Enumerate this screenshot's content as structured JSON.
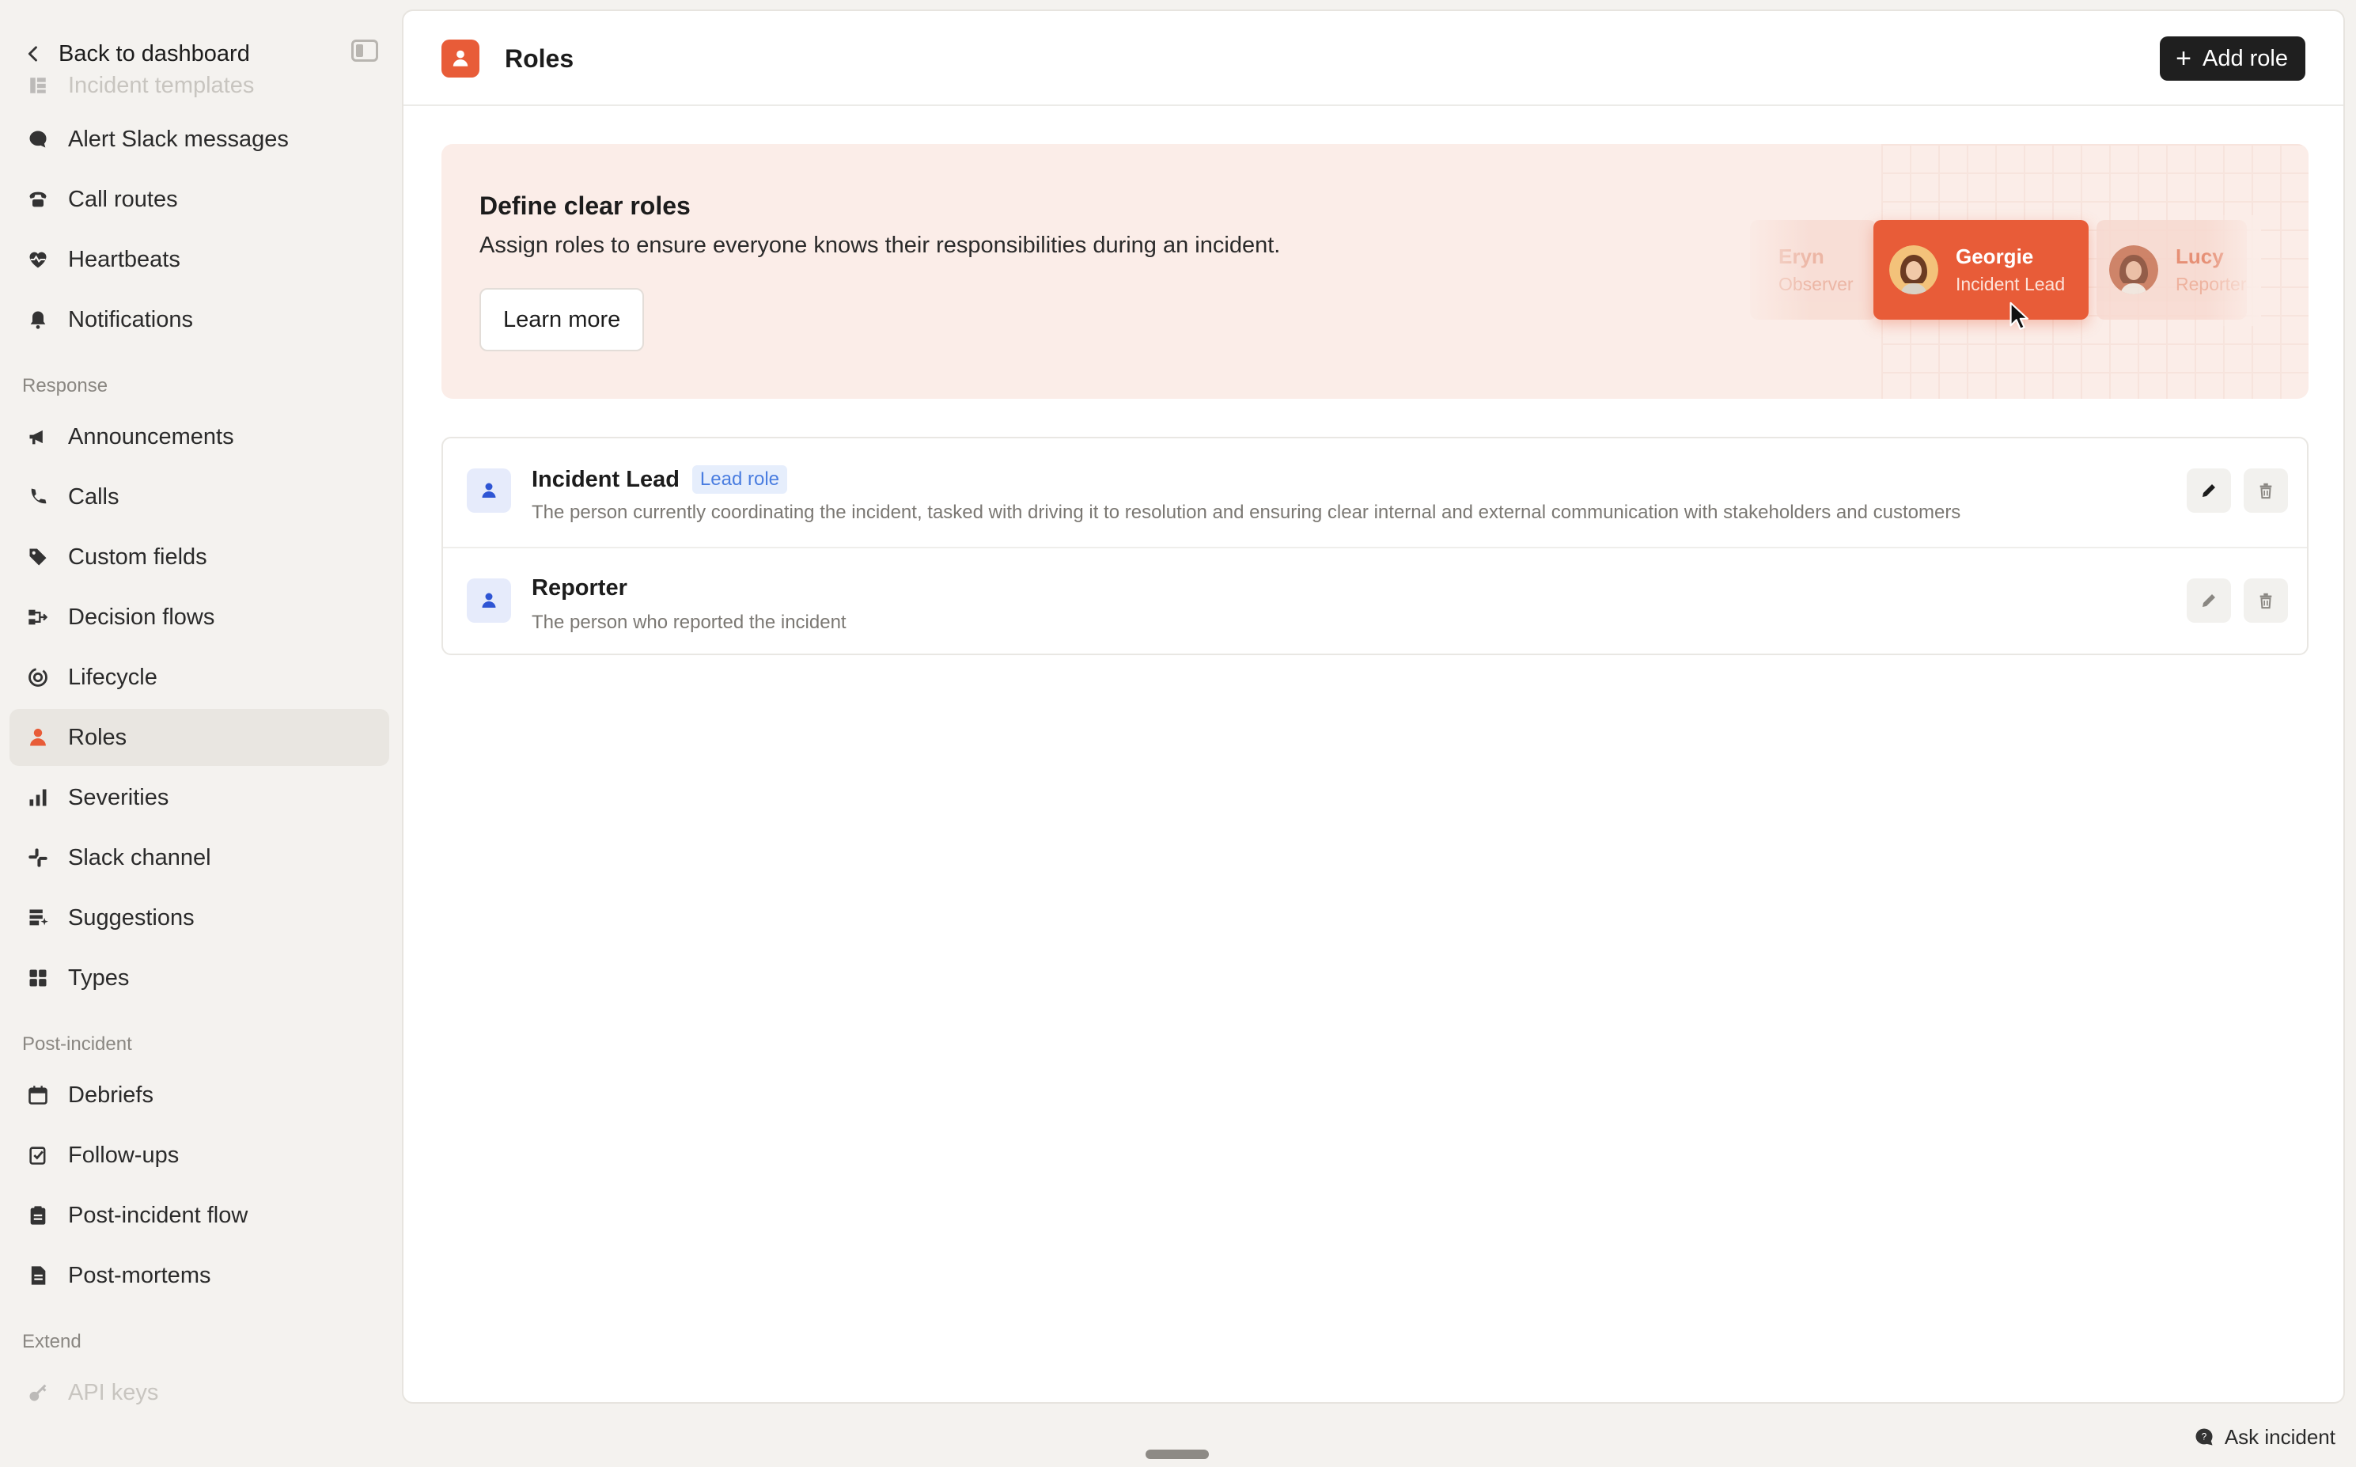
{
  "sidebar": {
    "back_label": "Back to dashboard",
    "items_top": [
      {
        "label": "Incident templates",
        "icon": "template-icon"
      },
      {
        "label": "Alert Slack messages",
        "icon": "chat-bubble-icon"
      },
      {
        "label": "Call routes",
        "icon": "phone-icon"
      },
      {
        "label": "Heartbeats",
        "icon": "heartbeat-icon"
      },
      {
        "label": "Notifications",
        "icon": "bell-icon"
      }
    ],
    "section_response": "Response",
    "items_response": [
      {
        "label": "Announcements",
        "icon": "megaphone-icon"
      },
      {
        "label": "Calls",
        "icon": "phone-icon"
      },
      {
        "label": "Custom fields",
        "icon": "tag-icon"
      },
      {
        "label": "Decision flows",
        "icon": "flow-icon"
      },
      {
        "label": "Lifecycle",
        "icon": "lifecycle-icon"
      },
      {
        "label": "Roles",
        "icon": "person-icon"
      },
      {
        "label": "Severities",
        "icon": "bar-chart-icon"
      },
      {
        "label": "Slack channel",
        "icon": "slack-icon"
      },
      {
        "label": "Suggestions",
        "icon": "suggestion-icon"
      },
      {
        "label": "Types",
        "icon": "grid-icon"
      }
    ],
    "section_post": "Post-incident",
    "items_post": [
      {
        "label": "Debriefs",
        "icon": "calendar-icon"
      },
      {
        "label": "Follow-ups",
        "icon": "follow-up-icon"
      },
      {
        "label": "Post-incident flow",
        "icon": "clipboard-icon"
      },
      {
        "label": "Post-mortems",
        "icon": "document-icon"
      }
    ],
    "section_extend": "Extend",
    "items_extend": [
      {
        "label": "API keys",
        "icon": "key-icon"
      }
    ]
  },
  "header": {
    "title": "Roles",
    "add_button": "Add role"
  },
  "banner": {
    "title": "Define clear roles",
    "description": "Assign roles to ensure everyone knows their responsibilities during an incident.",
    "learn_more": "Learn more",
    "cards": [
      {
        "name": "Eryn",
        "role": "Observer"
      },
      {
        "name": "Georgie",
        "role": "Incident Lead"
      },
      {
        "name": "Lucy",
        "role": "Reporter"
      }
    ]
  },
  "roles": [
    {
      "name": "Incident Lead",
      "badge": "Lead role",
      "description": "The person currently coordinating the incident, tasked with driving it to resolution and ensuring clear internal and external communication with stakeholders and customers"
    },
    {
      "name": "Reporter",
      "badge": "",
      "description": "The person who reported the incident"
    }
  ],
  "footer": {
    "ask_label": "Ask incident"
  },
  "colors": {
    "accent": "#e85c38",
    "banner_bg": "#fbede8",
    "active_nav_bg": "#e9e6e1",
    "role_icon_bg": "#e6ebfb",
    "role_icon_fg": "#2f55d4",
    "badge_fg": "#4a7de0"
  }
}
